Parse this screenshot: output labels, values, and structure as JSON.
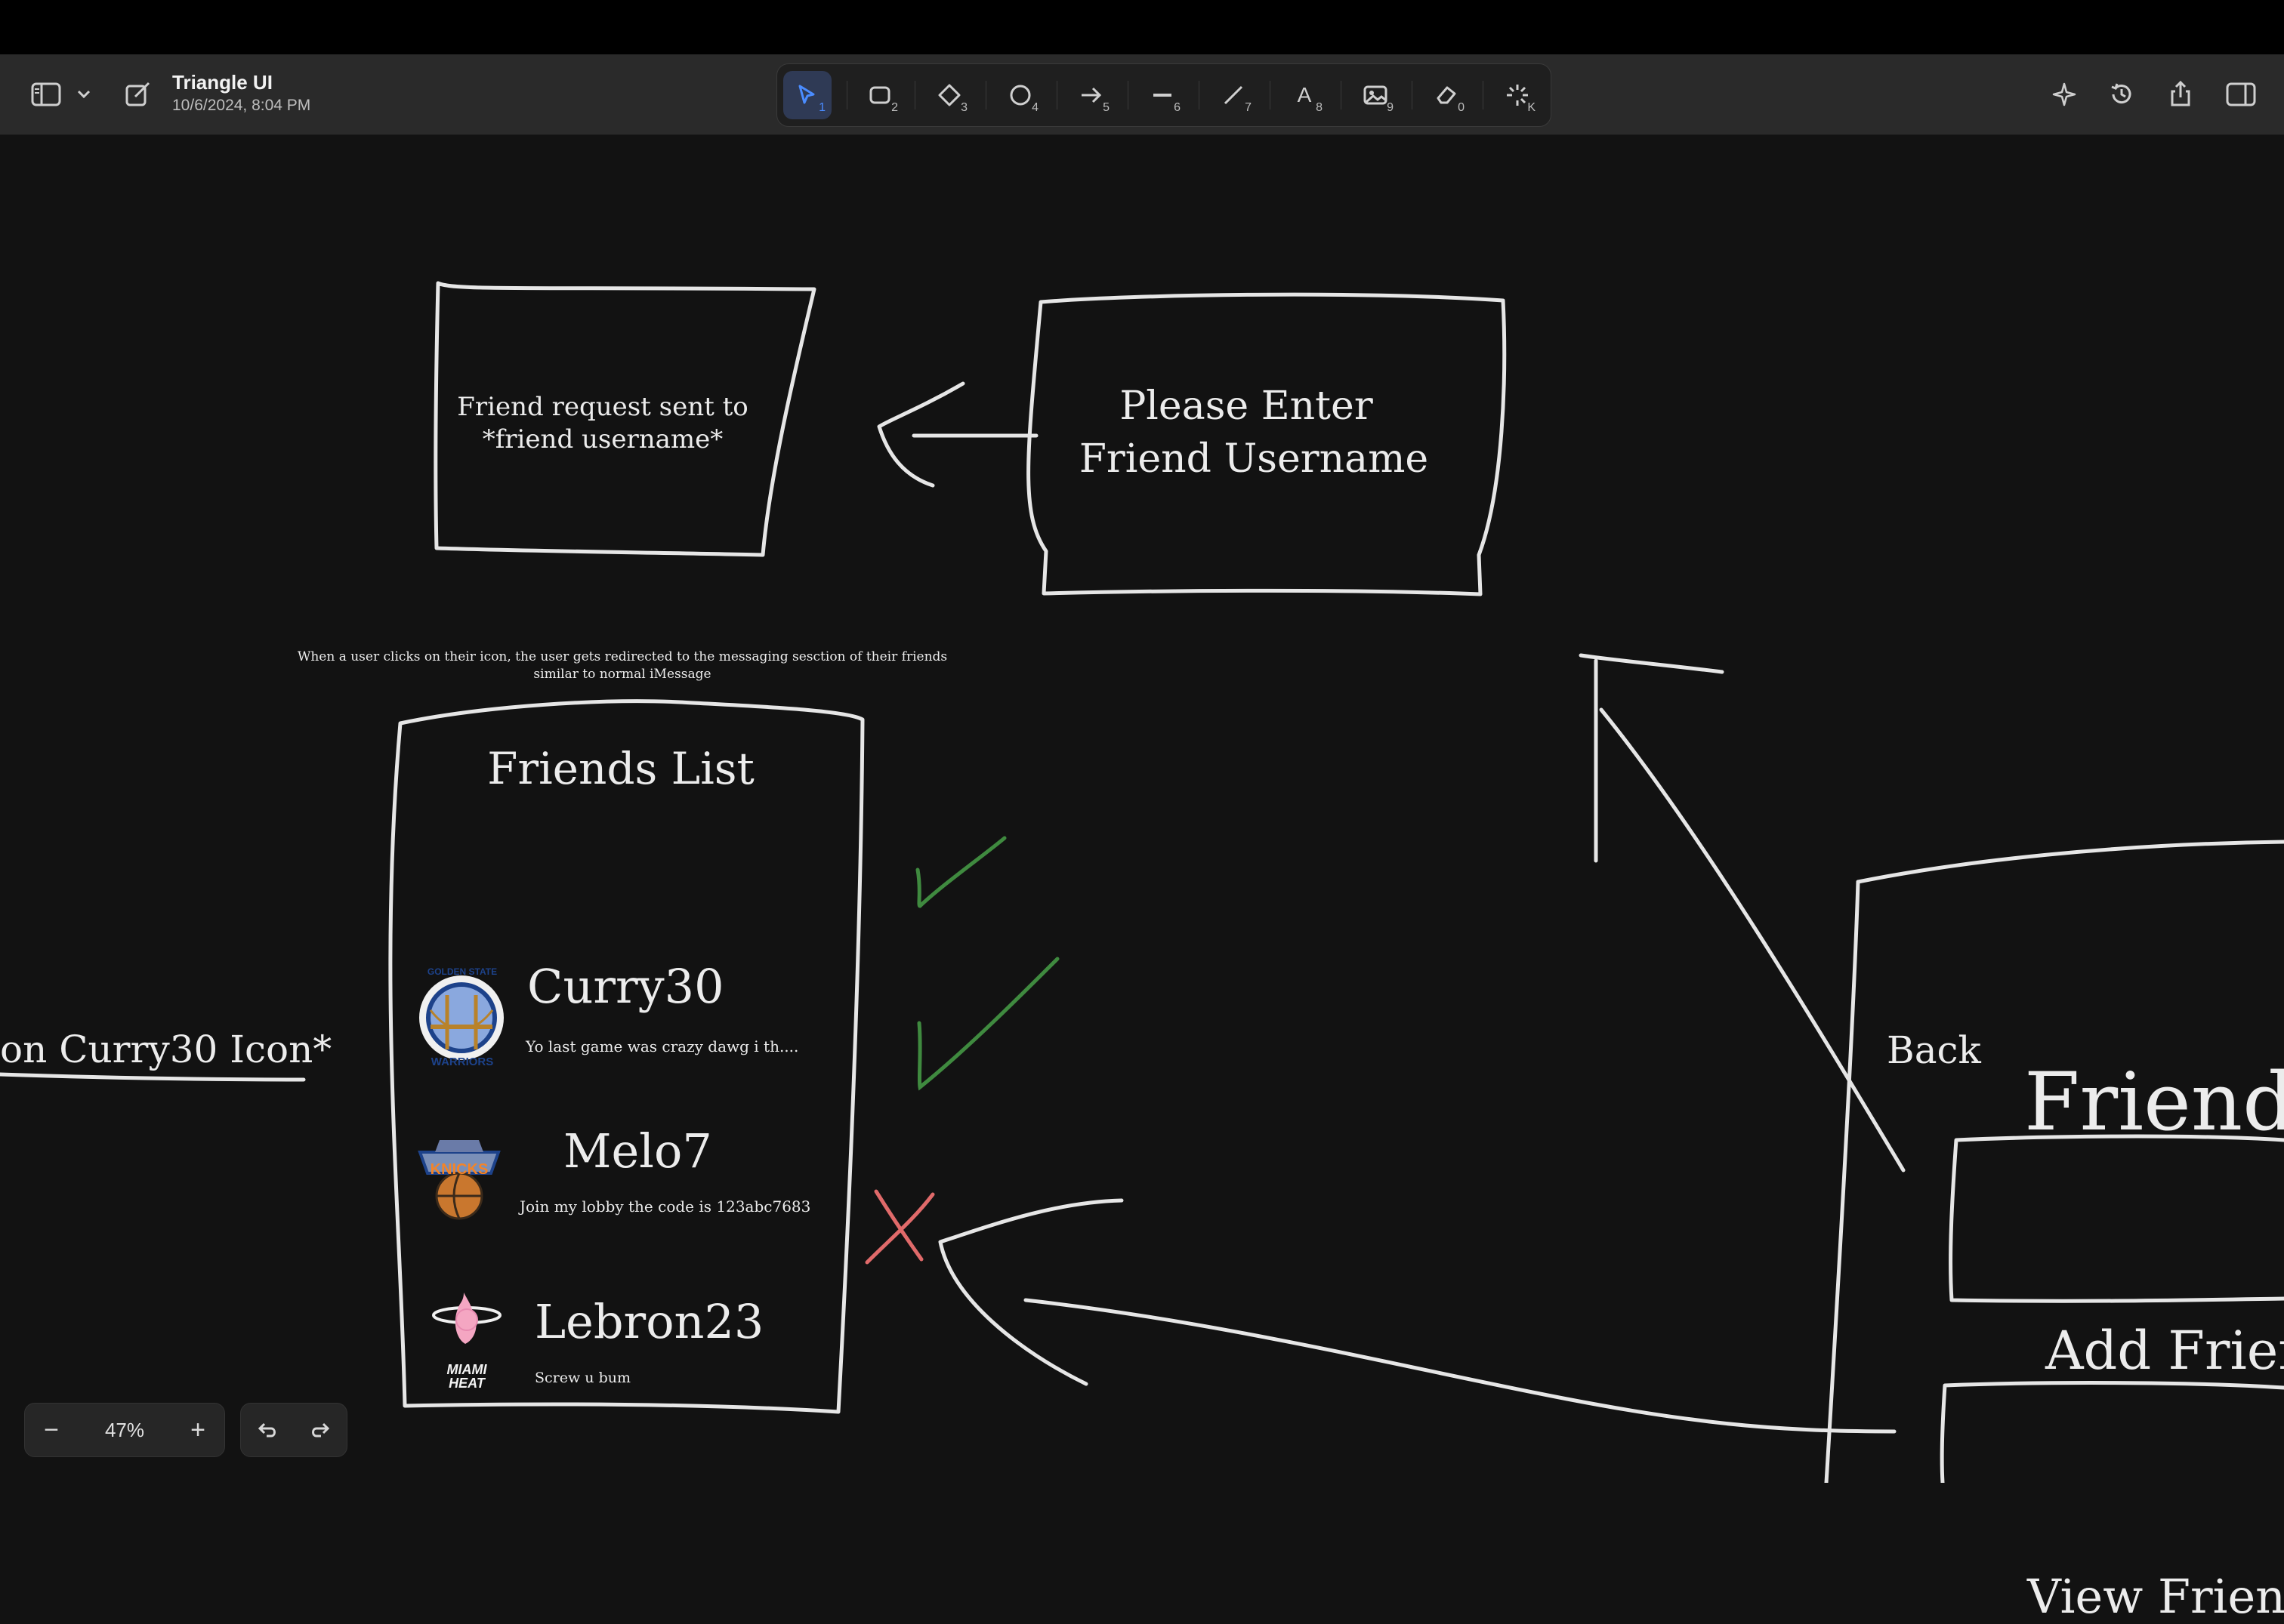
{
  "document": {
    "title": "Triangle UI",
    "date": "10/6/2024, 8:04 PM"
  },
  "toolbar": {
    "tools": [
      {
        "name": "select",
        "num": "1",
        "icon": "cursor-icon"
      },
      {
        "name": "rectangle",
        "num": "2",
        "icon": "rectangle-icon"
      },
      {
        "name": "diamond",
        "num": "3",
        "icon": "diamond-icon"
      },
      {
        "name": "ellipse",
        "num": "4",
        "icon": "ellipse-icon"
      },
      {
        "name": "arrow",
        "num": "5",
        "icon": "arrow-icon"
      },
      {
        "name": "line",
        "num": "6",
        "icon": "line-icon"
      },
      {
        "name": "draw",
        "num": "7",
        "icon": "pencil-icon"
      },
      {
        "name": "text",
        "num": "8",
        "icon": "text-icon"
      },
      {
        "name": "image",
        "num": "9",
        "icon": "image-icon"
      },
      {
        "name": "eraser",
        "num": "0",
        "icon": "eraser-icon"
      },
      {
        "name": "laser",
        "num": "K",
        "icon": "laser-icon"
      }
    ],
    "text_tool_glyph": "A",
    "active_tool": "select",
    "accent_color": "#4a8cff"
  },
  "canvas": {
    "friend_request_box": {
      "line1": "Friend request sent to",
      "line2": "*friend username*"
    },
    "enter_username_box": {
      "line1": "Please Enter",
      "line2": "Friend Username"
    },
    "note": {
      "line1": "When a user clicks on their icon, the user gets redirected to the messaging sesction of their friends",
      "line2": "similar to normal iMessage"
    },
    "friends_list": {
      "title": "Friends List",
      "items": [
        {
          "name": "Curry30",
          "message": "Yo last game was crazy dawg i th....",
          "team": "Golden State Warriors",
          "logo_text_top": "GOLDEN STATE",
          "logo_text_bottom": "WARRIORS",
          "mark": "check"
        },
        {
          "name": "Melo7",
          "message": "Join my lobby the code is 123abc7683",
          "team": "New York Knicks",
          "logo_text": "KNICKS",
          "mark": "check"
        },
        {
          "name": "Lebron23",
          "message": "Screw u bum",
          "team": "Miami Heat",
          "logo_text_top": "MIAMI",
          "logo_text_bottom": "HEAT",
          "mark": "cross"
        }
      ]
    },
    "left_partial_text": "on Curry30 Icon*",
    "right_panel": {
      "back": "Back",
      "title": "Friends",
      "add_button": "Add Friend",
      "view_button": "View Friends"
    },
    "colors": {
      "stroke": "#e6e6e6",
      "check": "#3f8a3f",
      "cross": "#e06a6a"
    }
  },
  "zoom": {
    "value": "47%",
    "minus": "−",
    "plus": "+"
  }
}
